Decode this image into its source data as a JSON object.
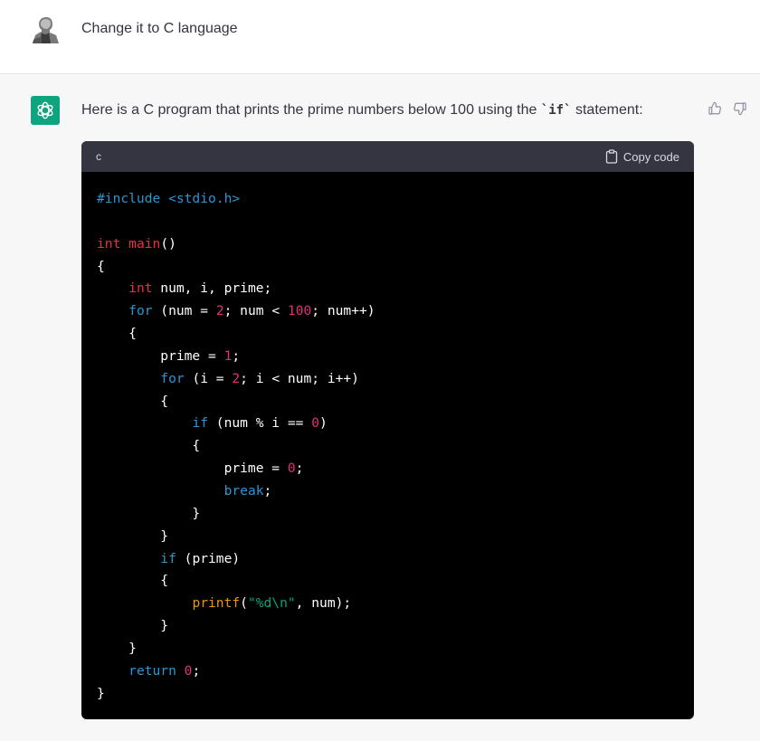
{
  "user_message": {
    "text": "Change it to C language"
  },
  "assistant_message": {
    "intro_before": "Here is a C program that prints the prime numbers below 100 using the ",
    "intro_code": "`if`",
    "intro_after": " statement:"
  },
  "code_block": {
    "language": "c",
    "copy_label": "Copy code",
    "lines": [
      [
        [
          "pp",
          "#include <stdio.h>"
        ]
      ],
      [],
      [
        [
          "ty",
          "int "
        ],
        [
          "ty",
          "main"
        ],
        [
          "",
          "()"
        ]
      ],
      [
        [
          "",
          "{"
        ]
      ],
      [
        [
          "",
          "    "
        ],
        [
          "ty",
          "int"
        ],
        [
          "",
          " num, i, prime;"
        ]
      ],
      [
        [
          "",
          "    "
        ],
        [
          "kw",
          "for"
        ],
        [
          "",
          " (num = "
        ],
        [
          "num",
          "2"
        ],
        [
          "",
          "; num < "
        ],
        [
          "num",
          "100"
        ],
        [
          "",
          "; num++)"
        ]
      ],
      [
        [
          "",
          "    {"
        ]
      ],
      [
        [
          "",
          "        prime = "
        ],
        [
          "num",
          "1"
        ],
        [
          "",
          ";"
        ]
      ],
      [
        [
          "",
          "        "
        ],
        [
          "kw",
          "for"
        ],
        [
          "",
          " (i = "
        ],
        [
          "num",
          "2"
        ],
        [
          "",
          "; i < num; i++)"
        ]
      ],
      [
        [
          "",
          "        {"
        ]
      ],
      [
        [
          "",
          "            "
        ],
        [
          "kw",
          "if"
        ],
        [
          "",
          " (num % i == "
        ],
        [
          "num",
          "0"
        ],
        [
          "",
          ")"
        ]
      ],
      [
        [
          "",
          "            {"
        ]
      ],
      [
        [
          "",
          "                prime = "
        ],
        [
          "num",
          "0"
        ],
        [
          "",
          ";"
        ]
      ],
      [
        [
          "",
          "                "
        ],
        [
          "kw",
          "break"
        ],
        [
          "",
          ";"
        ]
      ],
      [
        [
          "",
          "            }"
        ]
      ],
      [
        [
          "",
          "        }"
        ]
      ],
      [
        [
          "",
          "        "
        ],
        [
          "kw",
          "if"
        ],
        [
          "",
          " (prime)"
        ]
      ],
      [
        [
          "",
          "        {"
        ]
      ],
      [
        [
          "",
          "            "
        ],
        [
          "fn",
          "printf"
        ],
        [
          "",
          "("
        ],
        [
          "str",
          "\"%d\\n\""
        ],
        [
          "",
          ", num);"
        ]
      ],
      [
        [
          "",
          "        }"
        ]
      ],
      [
        [
          "",
          "    }"
        ]
      ],
      [
        [
          "",
          "    "
        ],
        [
          "kw",
          "return"
        ],
        [
          "",
          " "
        ],
        [
          "num",
          "0"
        ],
        [
          "",
          ";"
        ]
      ],
      [
        [
          "",
          "}"
        ]
      ]
    ]
  },
  "icons": {
    "user_avatar": "user-photo-avatar",
    "assistant_avatar": "openai-logo-icon",
    "copy": "clipboard-icon",
    "like": "thumbs-up-icon",
    "dislike": "thumbs-down-icon"
  },
  "colors": {
    "brand": "#10a37f",
    "code_bg": "#000000",
    "code_header_bg": "#343541",
    "keyword": "#2e95d3",
    "type": "#f22c3d",
    "number": "#df3079",
    "string": "#00a67d",
    "function": "#e9950c"
  }
}
